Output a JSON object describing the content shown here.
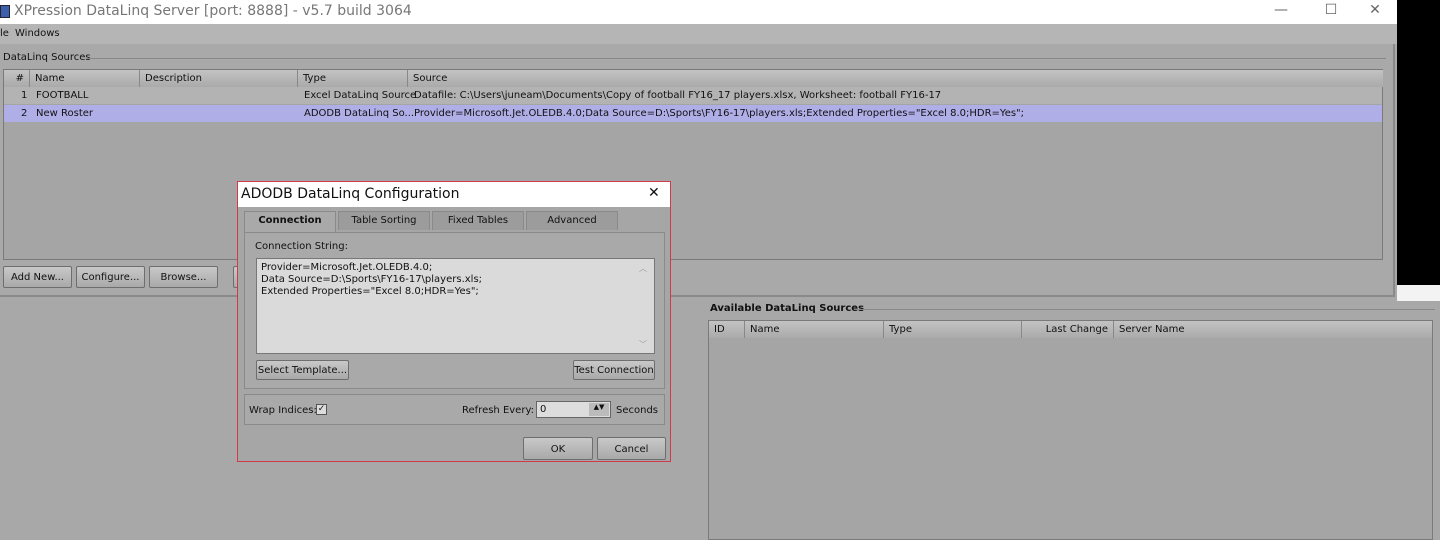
{
  "window": {
    "title": "XPression DataLinq Server [port: 8888] - v5.7 build 3064",
    "controls": {
      "minimize": "—",
      "maximize": "☐",
      "close": "✕"
    }
  },
  "menu": [
    "le",
    "Windows"
  ],
  "sources": {
    "group_label": "DataLinq Sources",
    "columns": [
      "#",
      "Name",
      "Description",
      "Type",
      "Source"
    ],
    "rows": [
      {
        "num": "1",
        "name": "FOOTBALL",
        "description": "",
        "type": "Excel DataLinq Source",
        "source": "Datafile: C:\\Users\\juneam\\Documents\\Copy of football FY16_17 players.xlsx, Worksheet: football FY16-17",
        "selected": false
      },
      {
        "num": "2",
        "name": "New Roster",
        "description": "",
        "type": "ADODB DataLinq So...",
        "source": "Provider=Microsoft.Jet.OLEDB.4.0;Data Source=D:\\Sports\\FY16-17\\players.xls;Extended Properties=\"Excel 8.0;HDR=Yes\";",
        "selected": true
      }
    ],
    "buttons": {
      "add": "Add New...",
      "configure": "Configure...",
      "browse": "Browse..."
    },
    "selected_row_color": "#b0aee6"
  },
  "available": {
    "group_label": "Available DataLinq Sources",
    "columns": [
      "ID",
      "Name",
      "Type",
      "Last Change",
      "Server Name"
    ]
  },
  "dialog": {
    "title": "ADODB DataLinq Configuration",
    "close": "✕",
    "tabs": [
      "Connection",
      "Table Sorting",
      "Fixed Tables",
      "Advanced"
    ],
    "active_tab": "Connection",
    "conn_label": "Connection String:",
    "conn_value": "Provider=Microsoft.Jet.OLEDB.4.0;\nData Source=D:\\Sports\\FY16-17\\players.xls;\nExtended Properties=\"Excel 8.0;HDR=Yes\";",
    "select_template": "Select Template...",
    "test_connection": "Test Connection",
    "wrap_label": "Wrap Indices:",
    "wrap_checked": true,
    "refresh_label": "Refresh Every:",
    "refresh_value": "0",
    "refresh_unit": "Seconds",
    "ok": "OK",
    "cancel": "Cancel",
    "border_color": "#d03a4a"
  }
}
